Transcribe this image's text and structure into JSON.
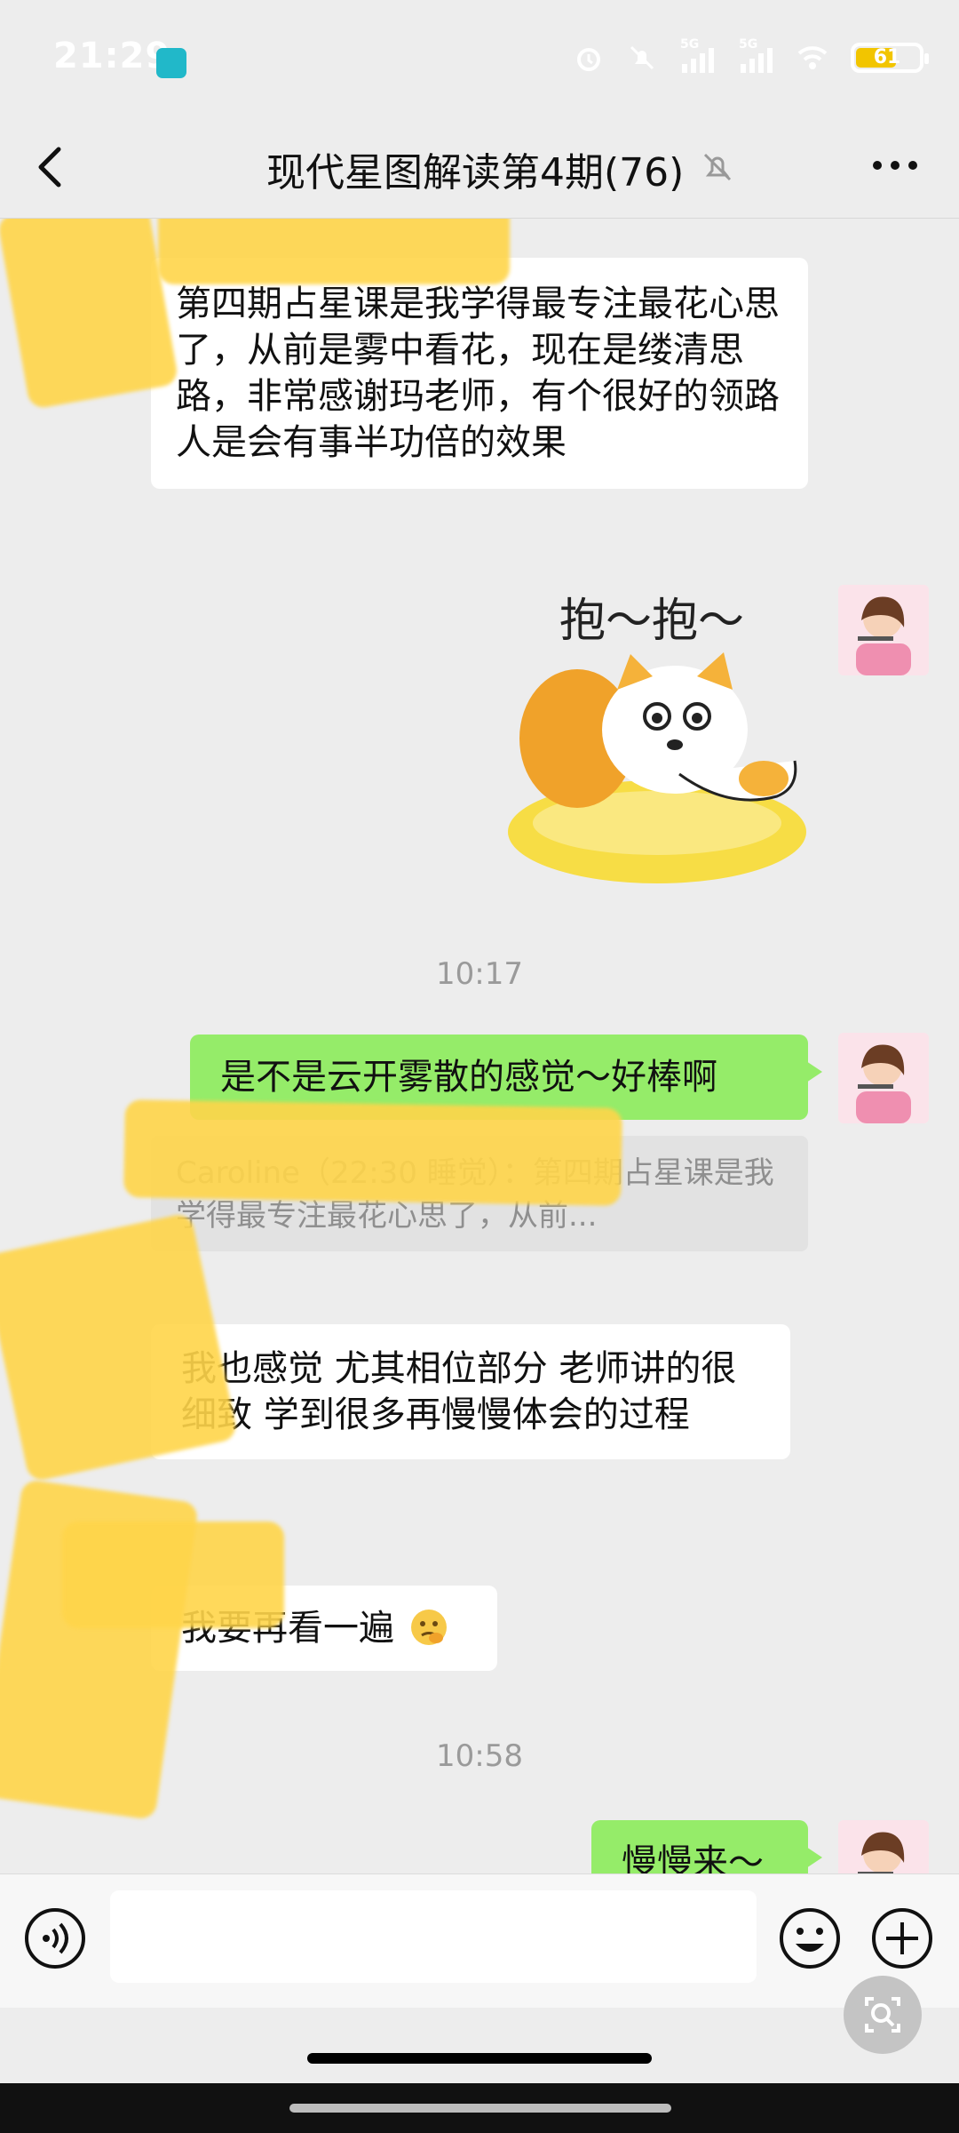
{
  "status_bar": {
    "time": "21:29",
    "network_1": "5G",
    "network_2": "5G",
    "battery": "61"
  },
  "header": {
    "title": "现代星图解读第4期(76)"
  },
  "messages": [
    {
      "type": "text",
      "side": "left",
      "text": "第四期占星课是我学得最专注最花心思了，从前是雾中看花，现在是缕清思路，非常感谢玛老师，有个很好的领路人是会有事半功倍的效果"
    },
    {
      "type": "sticker",
      "side": "right",
      "caption": "抱～抱～"
    },
    {
      "type": "time",
      "text": "10:17"
    },
    {
      "type": "text",
      "side": "right",
      "text": "是不是云开雾散的感觉～好棒啊"
    },
    {
      "type": "quote",
      "text": "Caroline（22:30 睡觉）：第四期占星课是我学得最专注最花心思了，从前..."
    },
    {
      "type": "text",
      "side": "left",
      "text": "我也感觉 尤其相位部分 老师讲的很细致 学到很多再慢慢体会的过程"
    },
    {
      "type": "text",
      "side": "left",
      "text": "我要再看一遍"
    },
    {
      "type": "time",
      "text": "10:58"
    },
    {
      "type": "text",
      "side": "right",
      "text": "慢慢来～"
    }
  ],
  "input": {
    "placeholder": ""
  },
  "colors": {
    "background": "#ededed",
    "bubble_green": "#95ec69",
    "bubble_white": "#ffffff",
    "redaction": "#ffd54a"
  }
}
